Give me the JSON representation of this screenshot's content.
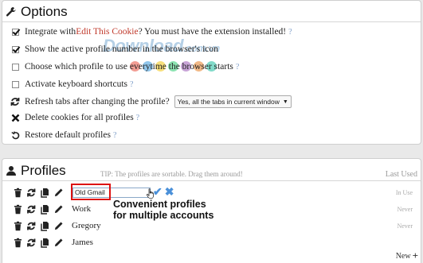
{
  "options": {
    "title": "Options",
    "integrate": {
      "prefix": "Integrate with ",
      "link": "Edit This Cookie",
      "suffix": "? You must have the extension installed!",
      "help": "?"
    },
    "show_active": {
      "label": "Show the active profile number in the browser's icon"
    },
    "choose_profile": {
      "label": "Choose which profile to use everytime the browser starts",
      "help": "?"
    },
    "keyboard": {
      "label": "Activate keyboard shortcuts",
      "help": "?"
    },
    "refresh": {
      "label": "Refresh tabs after changing the profile?",
      "select_value": "Yes, all the tabs in current window"
    },
    "delete_cookies": {
      "label": "Delete cookies for all profiles",
      "help": "?"
    },
    "restore": {
      "label": "Restore default profiles",
      "help": "?"
    }
  },
  "watermark": {
    "main": "Download",
    "domain": ".com.vn"
  },
  "profiles": {
    "title": "Profiles",
    "tip": "TIP: The profiles are sortable. Drag them around!",
    "last_used_header": "Last Used",
    "rows": [
      {
        "name": "Old Gmail",
        "last_used": "In Use"
      },
      {
        "name": "Work",
        "last_used": "Never"
      },
      {
        "name": "Gregory",
        "last_used": "Never"
      },
      {
        "name": "James",
        "last_used": "Never"
      }
    ],
    "annotation_line1": "Convenient profiles",
    "annotation_line2": "for multiple accounts",
    "new_label": "New",
    "new_plus": "+"
  },
  "colors": {
    "dot_colors": [
      "#e74c3c",
      "#3498db",
      "#f1c40f",
      "#2ecc71",
      "#9b59b6",
      "#e67e22",
      "#1abc9c"
    ]
  }
}
